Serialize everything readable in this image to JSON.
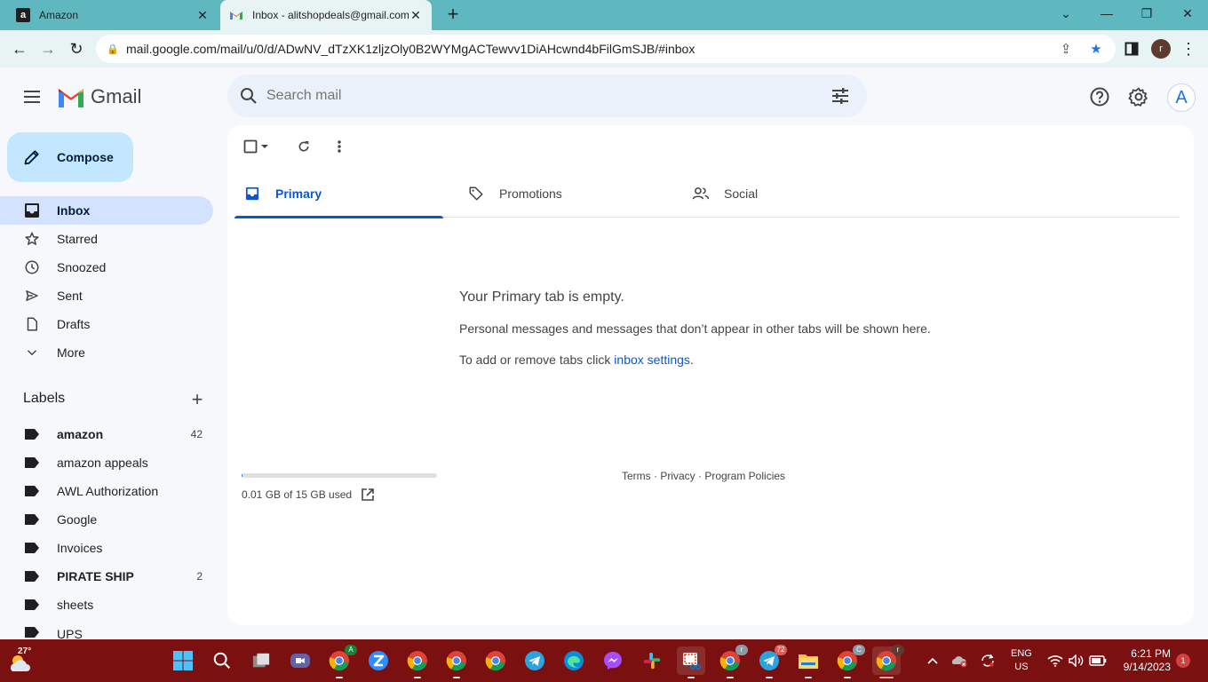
{
  "browser": {
    "tabs": [
      {
        "title": "Amazon",
        "favicon": "amazon-a"
      },
      {
        "title": "Inbox - alitshopdeals@gmail.com",
        "favicon": "gmail-m"
      }
    ],
    "url": "mail.google.com/mail/u/0/d/ADwNV_dTzXK1zljzOly0B2WYMgACTewvv1DiAHcwnd4bFilGmSJB/#inbox",
    "profile_initial": "r"
  },
  "gmail": {
    "product_name": "Gmail",
    "search_placeholder": "Search mail",
    "account_initial": "A",
    "compose_label": "Compose",
    "nav": [
      {
        "label": "Inbox"
      },
      {
        "label": "Starred"
      },
      {
        "label": "Snoozed"
      },
      {
        "label": "Sent"
      },
      {
        "label": "Drafts"
      },
      {
        "label": "More"
      }
    ],
    "labels_title": "Labels",
    "labels": [
      {
        "label": "amazon",
        "count": "42"
      },
      {
        "label": "amazon appeals",
        "count": ""
      },
      {
        "label": "AWL Authorization",
        "count": ""
      },
      {
        "label": "Google",
        "count": ""
      },
      {
        "label": "Invoices",
        "count": ""
      },
      {
        "label": "PIRATE SHIP",
        "count": "2"
      },
      {
        "label": "sheets",
        "count": ""
      },
      {
        "label": "UPS",
        "count": ""
      }
    ],
    "categories": [
      {
        "label": "Primary"
      },
      {
        "label": "Promotions"
      },
      {
        "label": "Social"
      }
    ],
    "empty_title": "Your Primary tab is empty.",
    "empty_desc": "Personal messages and messages that don’t appear in other tabs will be shown here.",
    "empty_hint_prefix": "To add or remove tabs click ",
    "empty_hint_link": "inbox settings",
    "empty_hint_suffix": ".",
    "storage_text": "0.01 GB of 15 GB used",
    "storage_fraction": 0.0007,
    "footer": "Terms · Privacy · Program Policies"
  },
  "taskbar": {
    "weather_temp": "27°",
    "lang_line1": "ENG",
    "lang_line2": "US",
    "time": "6:21 PM",
    "date": "9/14/2023",
    "notification_count": "1",
    "badge_chrome_a": "A",
    "badge_telegram": "72",
    "badge_chrome_r": "r",
    "badge_chrome_c": "C"
  },
  "colors": {
    "tabbar": "#5fb8c0",
    "compose_bg": "#c2e7ff",
    "nav_active": "#d3e3fd",
    "accent": "#0b57d0",
    "taskbar": "#7a1010"
  }
}
